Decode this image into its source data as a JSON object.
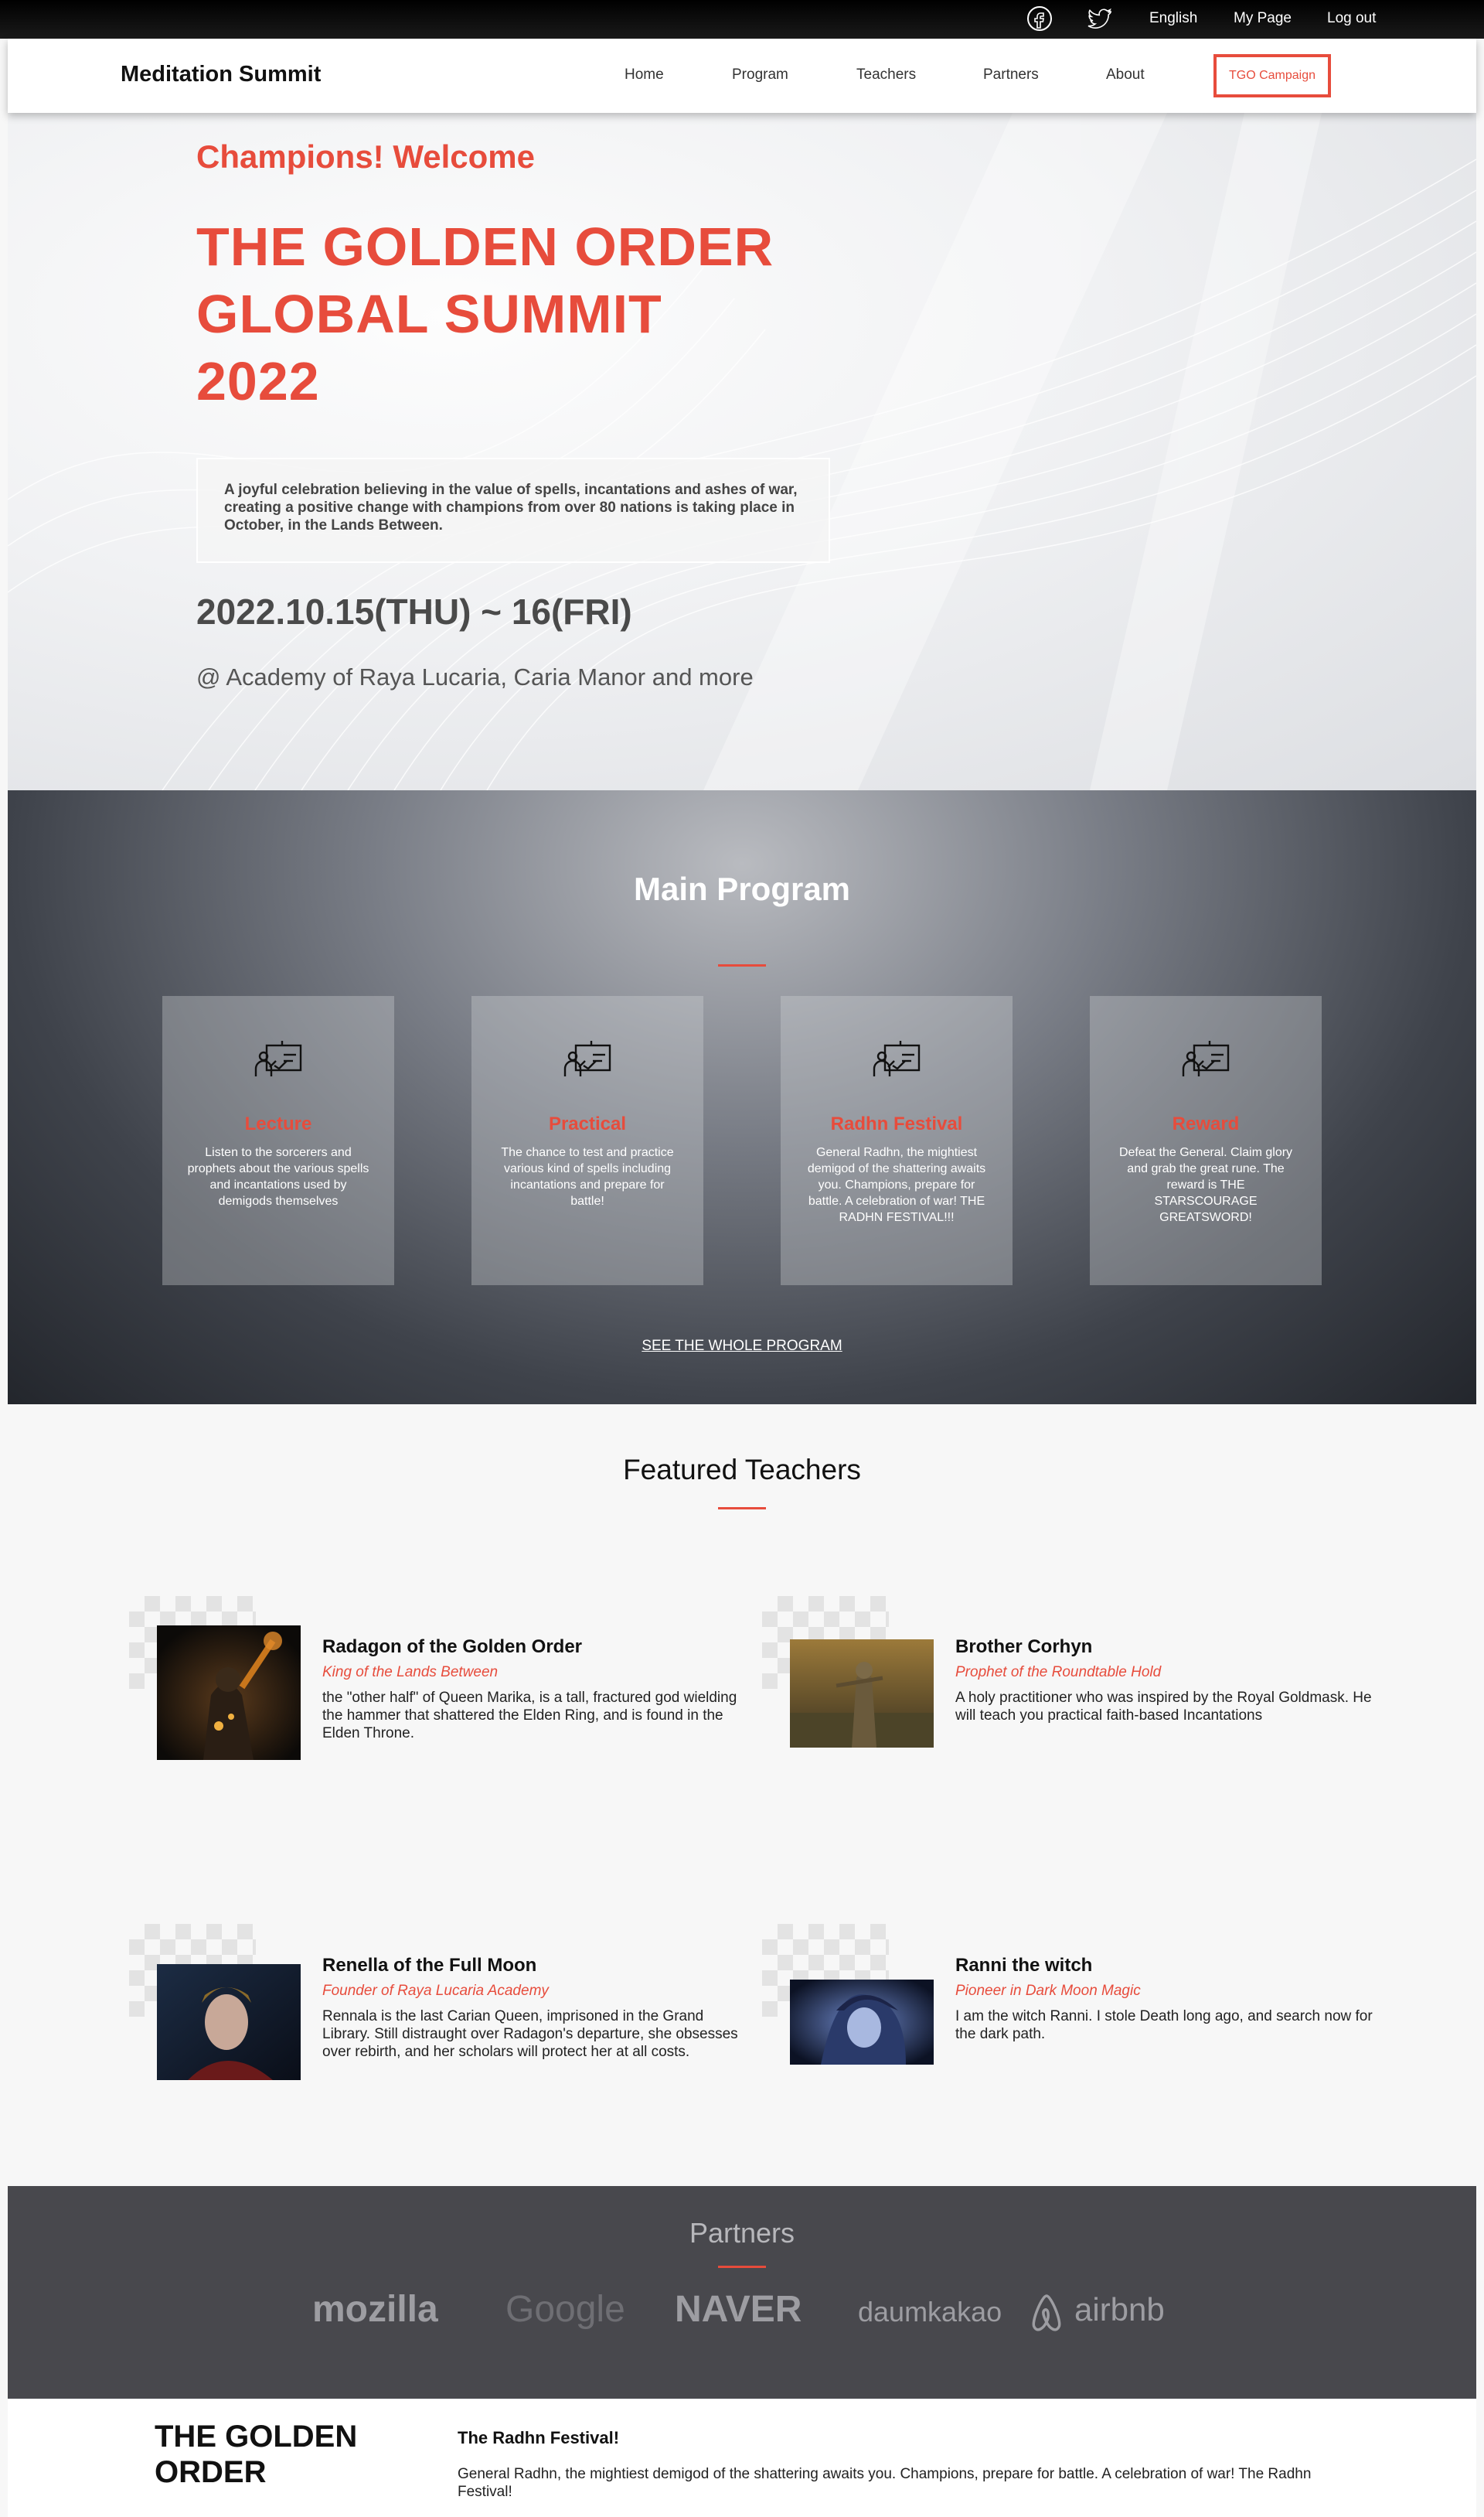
{
  "topbar": {
    "social": [
      {
        "icon": "facebook-icon"
      },
      {
        "icon": "twitter-icon"
      }
    ],
    "language": "English",
    "my_page": "My Page",
    "logout": "Log out"
  },
  "nav": {
    "logo": "Meditation Summit",
    "items": [
      "Home",
      "Program",
      "Teachers",
      "Partners",
      "About"
    ],
    "cta": "TGO Campaign"
  },
  "hero": {
    "welcome": "Champions! Welcome",
    "title_lines": [
      "THE GOLDEN ORDER",
      "GLOBAL SUMMIT",
      "2022"
    ],
    "description": "A joyful celebration believing in the value of spells, incantations and ashes of war, creating a positive change with champions from over 80 nations is taking place in October, in the Lands Between.",
    "date": "2022.10.15(THU) ~ 16(FRI)",
    "venue": "@ Academy of Raya Lucaria, Caria Manor and more"
  },
  "program": {
    "title": "Main Program",
    "cards": [
      {
        "title": "Lecture",
        "icon": "presentation-board-icon",
        "desc": "Listen to the sorcerers and prophets about the various spells and incantations used by demigods themselves"
      },
      {
        "title": "Practical",
        "icon": "presentation-board-icon",
        "desc": "The chance to test and practice various kind of spells including incantations and prepare for battle!"
      },
      {
        "title": "Radhn Festival",
        "icon": "presentation-board-icon",
        "desc": "General Radhn, the mightiest demigod of the shattering awaits you. Champions, prepare for battle. A celebration of war! THE RADHN FESTIVAL!!!"
      },
      {
        "title": "Reward",
        "icon": "presentation-board-icon",
        "desc": "Defeat the General. Claim glory and grab the great rune. The reward is THE STARSCOURAGE GREATSWORD!"
      }
    ],
    "more_link": "SEE THE WHOLE PROGRAM"
  },
  "teachers": {
    "title": "Featured Teachers",
    "items": [
      {
        "name": "Radagon of the Golden Order",
        "role": "King of the Lands Between",
        "bio": "the \"other half\" of Queen Marika, is a tall, fractured god wielding the hammer that shattered the Elden Ring, and is found in the Elden Throne."
      },
      {
        "name": "Brother Corhyn",
        "role": "Prophet of the Roundtable Hold",
        "bio": "A holy practitioner who was inspired by the Royal Goldmask. He will teach you practical faith-based Incantations"
      },
      {
        "name": "Renella of the Full Moon",
        "role": "Founder of Raya Lucaria Academy",
        "bio": "Rennala is the last Carian Queen, imprisoned in the Grand Library. Still distraught over Radagon's departure, she obsesses over rebirth, and her scholars will protect her at all costs."
      },
      {
        "name": "Ranni the witch",
        "role": "Pioneer in Dark Moon Magic",
        "bio": "I am the witch Ranni. I stole Death long ago, and search now for the dark path."
      }
    ]
  },
  "partners": {
    "title": "Partners",
    "logos": [
      "mozilla",
      "Google",
      "NAVER",
      "daumkakao",
      "airbnb"
    ]
  },
  "footer": {
    "logo": "THE GOLDEN ORDER",
    "heading": "The Radhn Festival!",
    "text": "General Radhn, the mightiest demigod of the shattering awaits you. Champions, prepare for battle. A celebration of war! The Radhn Festival!"
  },
  "colors": {
    "accent": "#e74c3c",
    "dark": "#48484d"
  }
}
